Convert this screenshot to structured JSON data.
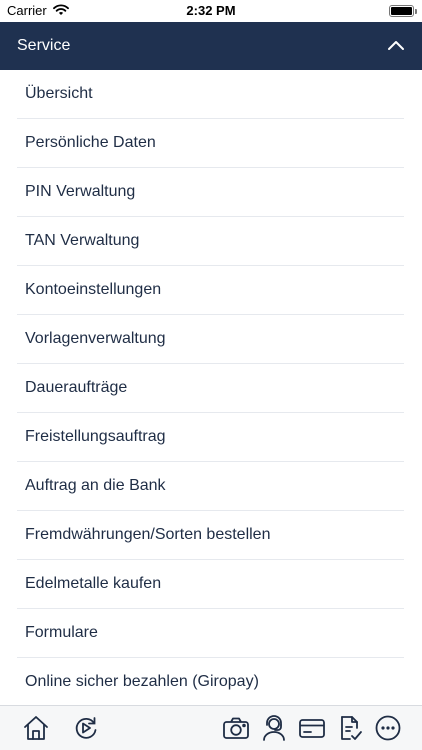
{
  "status_bar": {
    "carrier": "Carrier",
    "time": "2:32 PM",
    "battery_level": 1.0
  },
  "header": {
    "title": "Service",
    "collapse_icon": "chevron-up-icon"
  },
  "menu": {
    "items": [
      {
        "label": "Übersicht"
      },
      {
        "label": "Persönliche Daten"
      },
      {
        "label": "PIN Verwaltung"
      },
      {
        "label": "TAN Verwaltung"
      },
      {
        "label": "Kontoeinstellungen"
      },
      {
        "label": "Vorlagenverwaltung"
      },
      {
        "label": "Daueraufträge"
      },
      {
        "label": "Freistellungsauftrag"
      },
      {
        "label": "Auftrag an die Bank"
      },
      {
        "label": "Fremdwährungen/Sorten bestellen"
      },
      {
        "label": "Edelmetalle kaufen"
      },
      {
        "label": "Formulare"
      },
      {
        "label": "Online sicher bezahlen (Giropay)"
      }
    ]
  },
  "tab_bar": {
    "icons": [
      "home-icon",
      "refresh-icon",
      "camera-icon",
      "support-agent-icon",
      "card-icon",
      "document-check-icon",
      "more-icon"
    ]
  },
  "colors": {
    "header_background": "#1f3150",
    "text": "#1f2d45",
    "divider": "#e6e9ee",
    "tab_bar_background": "#f6f7f8"
  }
}
